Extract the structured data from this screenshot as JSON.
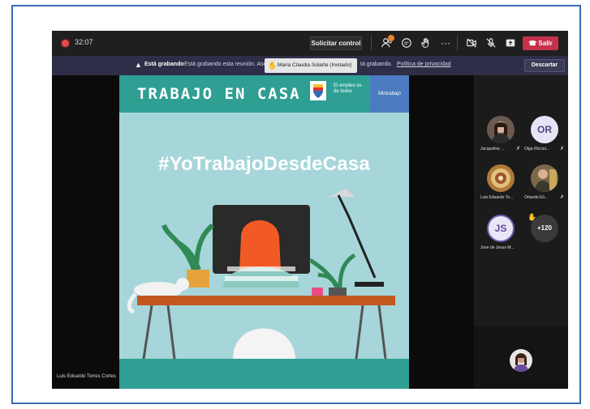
{
  "topbar": {
    "timer": "32:07",
    "request_control_label": "Solicitar control",
    "leave_label": "Salir",
    "more_label": "···"
  },
  "banner": {
    "recording_bold": "Está grabando",
    "recording_text": "Está grabando esta reunión. Aseg",
    "recording_text_tail": "tá grabando.",
    "privacy_link": "Política de privacidad",
    "tooltip_name": "Maria Claudia Solarte (Invitado)",
    "dismiss_label": "Descartar"
  },
  "share": {
    "header_title": "TRABAJO EN CASA",
    "empleo_text": "El empleo es de todos",
    "mintrabajo": "Mintrabajo",
    "hashtag": "#YoTrabajoDesdeCasa"
  },
  "presenter_name": "Luis Eduardo Torres Cortes",
  "participants": [
    {
      "name": "Jacqueline ...",
      "initials": ""
    },
    {
      "name": "Olga Ricciul...",
      "initials": "OR"
    },
    {
      "name": "Luis Eduardo To...",
      "initials": ""
    },
    {
      "name": "Orlando Eli...",
      "initials": ""
    },
    {
      "name": "Jose de Jesus M...",
      "initials": "JS"
    }
  ],
  "overflow_count": "+120",
  "colors": {
    "leave": "#c4314b",
    "banner": "#2e2e48",
    "share_header": "#2f9e93",
    "share_bg": "#a6d6d9",
    "frame_border": "#3b6bb5"
  }
}
